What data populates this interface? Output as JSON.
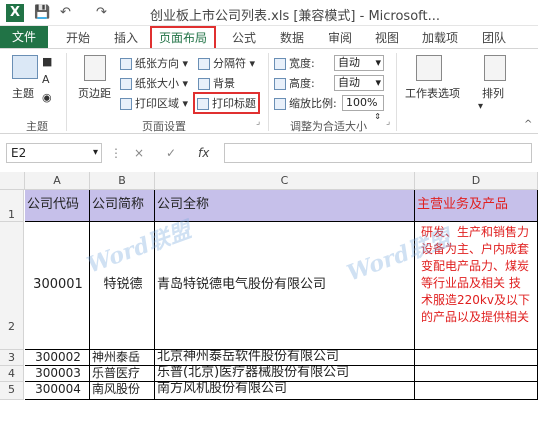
{
  "titlebar": {
    "app_icon": "X",
    "save_icon": "💾",
    "undo_icon": "↶",
    "redo_icon": "↷",
    "title": "创业板上市公司列表.xls  [兼容模式] - Microsoft..."
  },
  "tabs": [
    "文件",
    "开始",
    "插入",
    "页面布局",
    "公式",
    "数据",
    "审阅",
    "视图",
    "加载项",
    "团队"
  ],
  "ribbon": {
    "theme": "主题",
    "margins": "页边距",
    "orientation": "纸张方向",
    "size": "纸张大小",
    "print_area": "打印区域",
    "breaks": "分隔符",
    "background": "背景",
    "print_titles": "打印标题",
    "width_label": "宽度:",
    "height_label": "高度:",
    "scale_label": "缩放比例:",
    "width_value": "自动",
    "height_value": "自动",
    "scale_value": "100%",
    "sheet_options": "工作表选项",
    "arrange": "排列",
    "group_theme": "主题",
    "group_page_setup": "页面设置",
    "group_scale": "调整为合适大小"
  },
  "formula_bar": {
    "name_box": "E2",
    "cancel": "×",
    "enter": "✓",
    "fx": "fx",
    "value": ""
  },
  "columns": [
    "A",
    "B",
    "C",
    "D"
  ],
  "rows": [
    "1",
    "2",
    "3",
    "4",
    "5"
  ],
  "header_row": {
    "a": "公司代码",
    "b": "公司简称",
    "c": "公司全称",
    "d": "主营业务及产品"
  },
  "data_rows": [
    {
      "a": "300001",
      "b": "特锐德",
      "c": "青岛特锐德电气股份有限公司",
      "d": "研发、生产和销售力设备为主、户内成套变配电产品力、煤炭等行业品及相关 技术服造220kv及以下的产品以及提供相关"
    },
    {
      "a": "300002",
      "b": "神州泰岳",
      "c": "北京神州泰岳软件股份有限公司",
      "d": ""
    },
    {
      "a": "300003",
      "b": "乐普医疗",
      "c": "乐普(北京)医疗器械股份有限公司",
      "d": ""
    },
    {
      "a": "300004",
      "b": "南风股份",
      "c": "南方风机股份有限公司",
      "d": ""
    }
  ],
  "watermark": "Word联盟"
}
